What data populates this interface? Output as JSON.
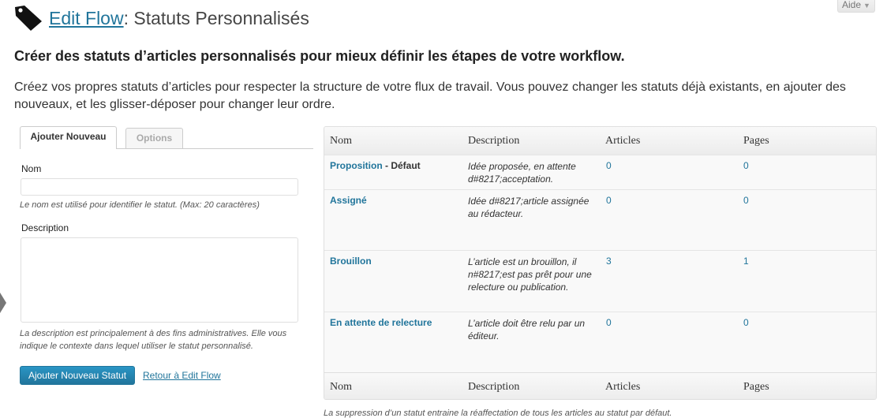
{
  "help_tab": {
    "label": "Aide"
  },
  "header": {
    "link": "Edit Flow",
    "separator": ":",
    "title": " Statuts Personnalisés"
  },
  "subheading": "Créer des statuts d’articles personnalisés pour mieux définir les étapes de votre workflow.",
  "intro": "Créez vos propres statuts d’articles pour respecter la structure de votre flux de travail. Vous pouvez changer les statuts déjà existants, en ajouter des nouveaux, et les glisser-déposer pour changer leur ordre.",
  "tabs": [
    {
      "label": "Ajouter Nouveau"
    },
    {
      "label": "Options"
    }
  ],
  "form": {
    "name_label": "Nom",
    "name_value": "",
    "name_hint": "Le nom est utilisé pour identifier le statut. (Max: 20 caractères)",
    "description_label": "Description",
    "description_value": "",
    "description_hint": "La description est principalement à des fins administratives. Elle vous indique le contexte dans lequel utiliser le statut personnalisé.",
    "submit_label": "Ajouter Nouveau Statut",
    "back_link": "Retour à Edit Flow"
  },
  "table": {
    "columns": [
      "Nom",
      "Description",
      "Articles",
      "Pages"
    ],
    "rows": [
      {
        "name": "Proposition",
        "suffix": " - Défaut",
        "description": "Idée proposée, en attente d#8217;acceptation.",
        "articles": "0",
        "pages": "0"
      },
      {
        "name": "Assigné",
        "suffix": "",
        "description": "Idée d#8217;article assignée au rédacteur.",
        "articles": "0",
        "pages": "0"
      },
      {
        "name": "Brouillon",
        "suffix": "",
        "description": "L’article est un brouillon, il n#8217;est pas prêt pour une relecture ou publication.",
        "articles": "3",
        "pages": "1"
      },
      {
        "name": "En attente de relecture",
        "suffix": "",
        "description": "L’article doit être relu par un éditeur.",
        "articles": "0",
        "pages": "0"
      }
    ]
  },
  "footnote": "La suppression d’un statut entraine la réaffectation de tous les articles au statut par défaut.",
  "icons": {
    "header": "tag-icon",
    "help_toggle": "triangle-down-icon",
    "resize": "resize-grip-icon",
    "side": "collapse-arrow-icon"
  },
  "colors": {
    "link": "#21759b",
    "primary_button": "#21759b",
    "text": "#333333"
  }
}
